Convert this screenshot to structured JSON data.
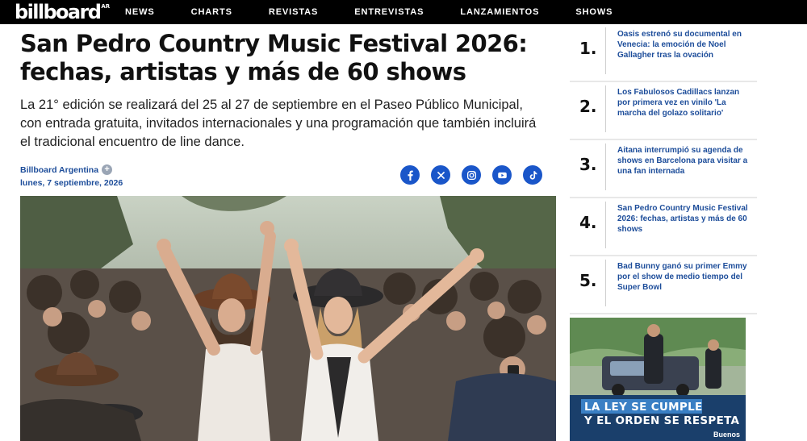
{
  "brand": {
    "logo_text": "billboard",
    "logo_sup": "AR"
  },
  "nav": [
    {
      "label": "NEWS"
    },
    {
      "label": "CHARTS"
    },
    {
      "label": "REVISTAS"
    },
    {
      "label": "ENTREVISTAS"
    },
    {
      "label": "LANZAMIENTOS"
    },
    {
      "label": "SHOWS"
    }
  ],
  "article": {
    "headline": "San Pedro Country Music Festival 2026: fechas, artistas y más de 60 shows",
    "dek": "La 21° edición se realizará del 25 al 27 de septiembre en el Paseo Público Municipal, con entrada gratuita, invitados internacionales y una programación que también incluirá el tradicional encuentro de line dance.",
    "author": "Billboard Argentina",
    "author_plus": "+",
    "date": "lunes, 7 septiembre, 2026",
    "social": [
      "facebook-icon",
      "x-icon",
      "instagram-icon",
      "youtube-icon",
      "tiktok-icon"
    ]
  },
  "sidebar": {
    "items": [
      {
        "num": "1.",
        "text": "Oasis estrenó su documental en Venecia: la emoción de Noel Gallagher tras la ovación"
      },
      {
        "num": "2.",
        "text": "Los Fabulosos Cadillacs lanzan por primera vez en vinilo 'La marcha del golazo solitario'"
      },
      {
        "num": "3.",
        "text": "Aitana interrumpió su agenda de shows en Barcelona para visitar a una fan internada"
      },
      {
        "num": "4.",
        "text": "San Pedro Country Music Festival 2026: fechas, artistas y más de 60 shows"
      },
      {
        "num": "5.",
        "text": "Bad Bunny ganó su primer Emmy por el show de medio tiempo del Super Bowl"
      }
    ]
  },
  "ad": {
    "line1": "LA LEY SE CUMPLE",
    "line2": "Y EL ORDEN SE RESPETA",
    "brand": "Buenos"
  },
  "colors": {
    "link": "#1d4d9a",
    "social": "#1a56c9",
    "topbar": "#000000"
  }
}
